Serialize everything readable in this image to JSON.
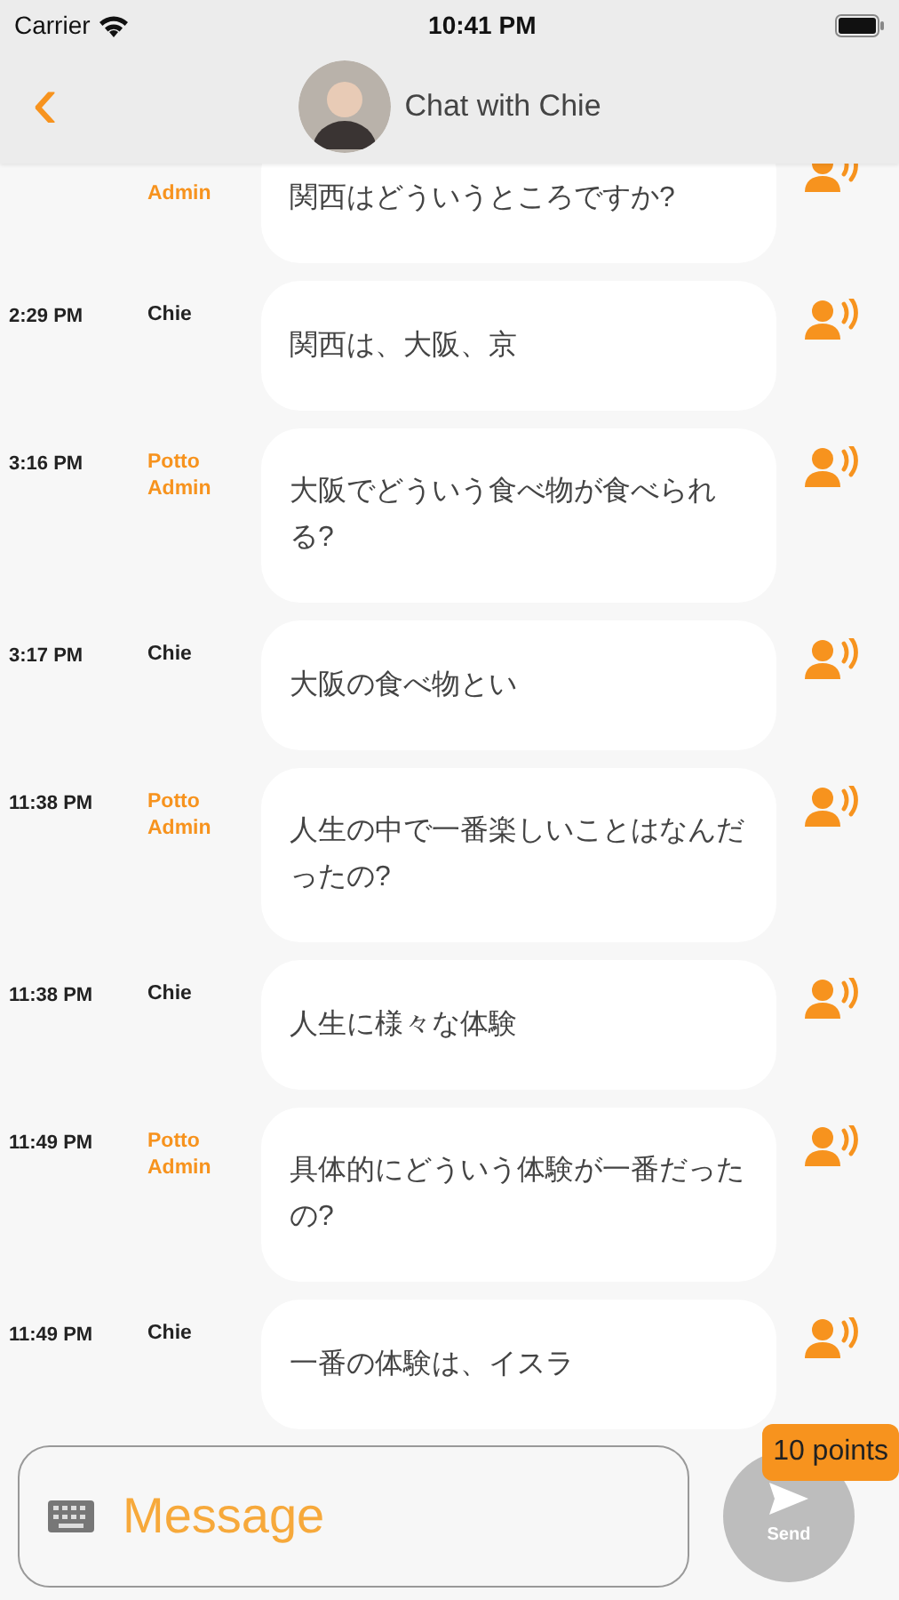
{
  "status_bar": {
    "carrier": "Carrier",
    "time": "10:41 PM"
  },
  "header": {
    "back": "‹",
    "title": "Chat with Chie"
  },
  "messages": [
    {
      "kind": "admin",
      "sender": "Admin",
      "text": "関西はどういうところですか?"
    },
    {
      "kind": "user",
      "time": "2:29 PM",
      "sender": "Chie",
      "text": "関西は、大阪、京"
    },
    {
      "kind": "admin",
      "time": "3:16 PM",
      "sender": "Potto Admin",
      "text": "大阪でどういう食べ物が食べられる?"
    },
    {
      "kind": "user",
      "time": "3:17 PM",
      "sender": "Chie",
      "text": "大阪の食べ物とい"
    },
    {
      "kind": "admin",
      "time": "11:38 PM",
      "sender": "Potto Admin",
      "text": "人生の中で一番楽しいことはなんだったの?"
    },
    {
      "kind": "user",
      "time": "11:38 PM",
      "sender": "Chie",
      "text": "人生に様々な体験"
    },
    {
      "kind": "admin",
      "time": "11:49 PM",
      "sender": "Potto Admin",
      "text": "具体的にどういう体験が一番だったの?"
    },
    {
      "kind": "user",
      "time": "11:49 PM",
      "sender": "Chie",
      "text": "一番の体験は、イスラ"
    }
  ],
  "composer": {
    "placeholder": "Message",
    "send": "Send",
    "points": "10 points"
  }
}
